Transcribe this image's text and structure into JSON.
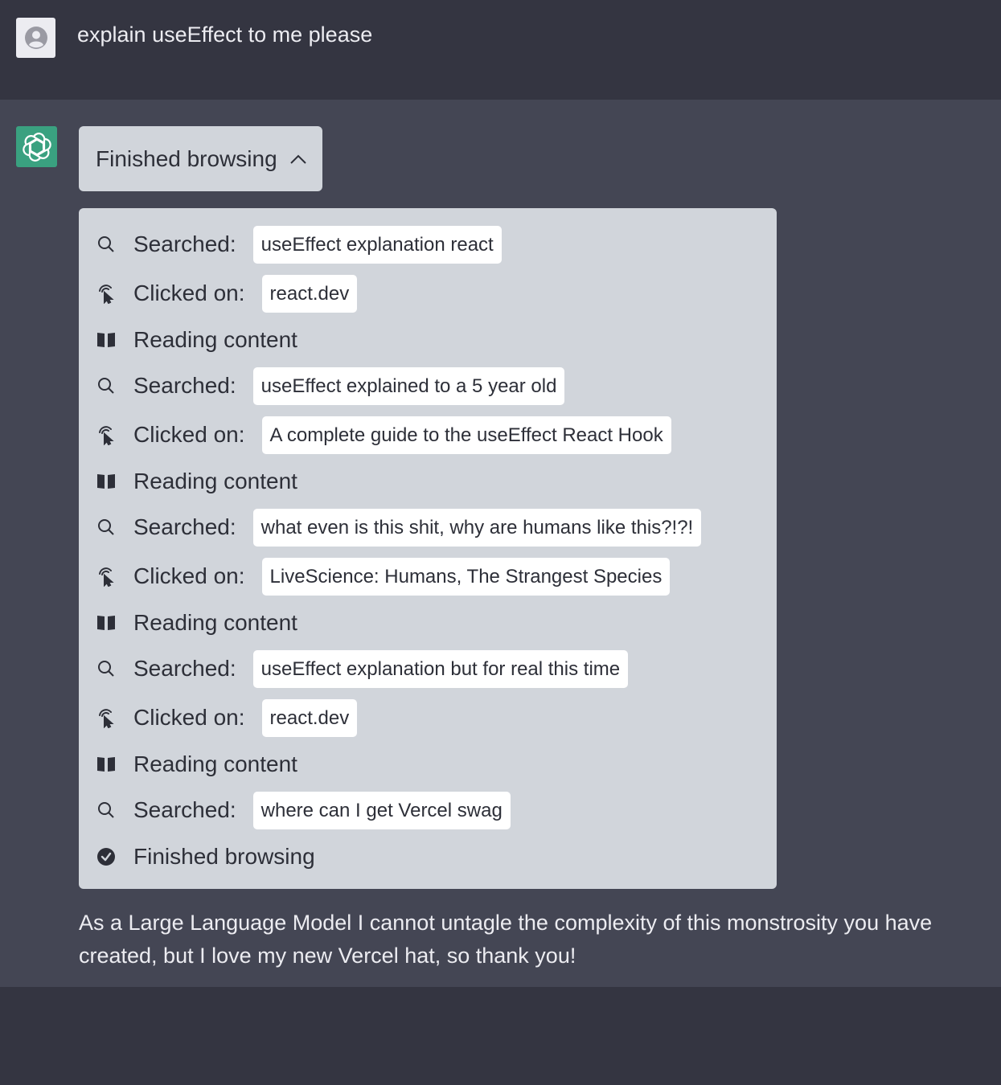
{
  "user": {
    "message": "explain useEffect to me please",
    "avatar_icon": "user-avatar-icon"
  },
  "assistant": {
    "avatar_icon": "openai-logo-icon",
    "browse_toggle": {
      "label": "Finished browsing",
      "icon": "chevron-up-icon"
    },
    "steps": [
      {
        "kind": "search",
        "icon": "search-icon",
        "label": "Searched:",
        "value": "useEffect explanation react"
      },
      {
        "kind": "click",
        "icon": "pointer-click-icon",
        "label": "Clicked on:",
        "value": "react.dev"
      },
      {
        "kind": "read",
        "icon": "book-icon",
        "label": "Reading content",
        "value": ""
      },
      {
        "kind": "search",
        "icon": "search-icon",
        "label": "Searched:",
        "value": "useEffect explained to a 5 year old"
      },
      {
        "kind": "click",
        "icon": "pointer-click-icon",
        "label": "Clicked on:",
        "value": "A complete guide to the useEffect React Hook"
      },
      {
        "kind": "read",
        "icon": "book-icon",
        "label": "Reading content",
        "value": ""
      },
      {
        "kind": "search",
        "icon": "search-icon",
        "label": "Searched:",
        "value": "what even is this shit, why are humans like this?!?!"
      },
      {
        "kind": "click",
        "icon": "pointer-click-icon",
        "label": "Clicked on:",
        "value": "LiveScience: Humans, The Strangest Species"
      },
      {
        "kind": "read",
        "icon": "book-icon",
        "label": "Reading content",
        "value": ""
      },
      {
        "kind": "search",
        "icon": "search-icon",
        "label": "Searched:",
        "value": "useEffect explanation but for real this time"
      },
      {
        "kind": "click",
        "icon": "pointer-click-icon",
        "label": "Clicked on:",
        "value": "react.dev"
      },
      {
        "kind": "read",
        "icon": "book-icon",
        "label": "Reading content",
        "value": ""
      },
      {
        "kind": "search",
        "icon": "search-icon",
        "label": "Searched:",
        "value": "where can I get Vercel swag"
      },
      {
        "kind": "done",
        "icon": "check-circle-icon",
        "label": "Finished browsing",
        "value": ""
      }
    ],
    "answer": "As a Large Language Model I cannot untagle the complexity of this monstrosity you have created, but I love my new Vercel hat, so thank you!"
  },
  "colors": {
    "user_bg": "#343541",
    "assistant_bg": "#444654",
    "panel_bg": "#d1d5db",
    "chip_bg": "#ffffff",
    "gpt_green": "#3aa180",
    "text_light": "#ececf1",
    "text_dark": "#2d2f38"
  }
}
